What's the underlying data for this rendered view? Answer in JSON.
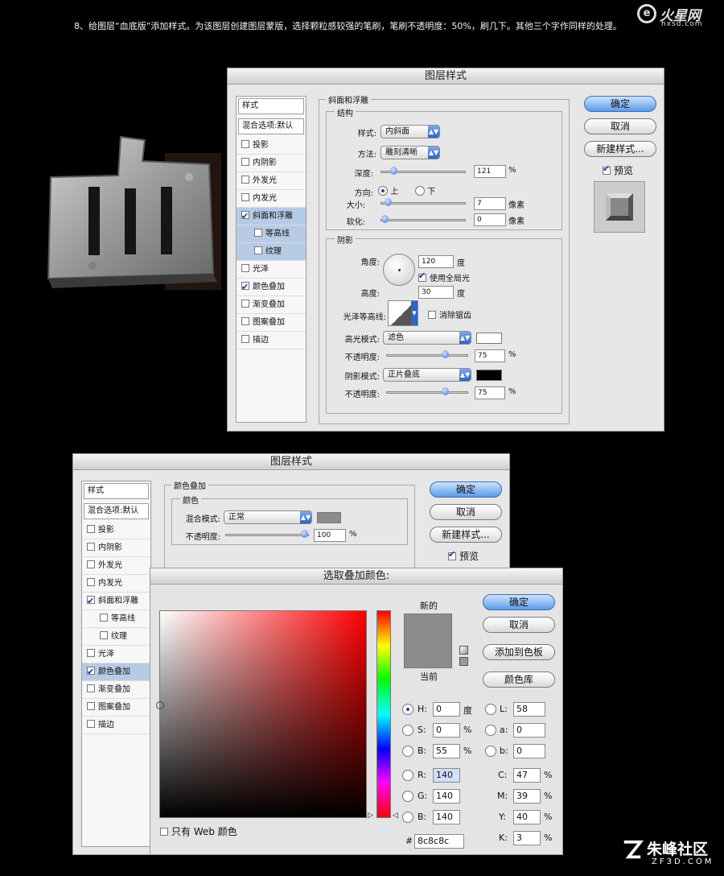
{
  "instruction": "8、给图层“血底版”添加样式。为该图层创建图层蒙版，选择颗粒感较强的笔刷，笔刷不透明度：50%，刷几下。其他三个字作同样的处理。",
  "top_logo": {
    "main": "火星网",
    "sub": "hxsd.com"
  },
  "bottom_logo": {
    "main": "朱峰社区",
    "sub": "ZF3D.COM"
  },
  "dialog1": {
    "title": "图层样式",
    "styles_header": "样式",
    "blend_default": "混合选项:默认",
    "items": [
      {
        "label": "投影",
        "checked": false,
        "active": false,
        "sub": false
      },
      {
        "label": "内阴影",
        "checked": false,
        "active": false,
        "sub": false
      },
      {
        "label": "外发光",
        "checked": false,
        "active": false,
        "sub": false
      },
      {
        "label": "内发光",
        "checked": false,
        "active": false,
        "sub": false
      },
      {
        "label": "斜面和浮雕",
        "checked": true,
        "active": true,
        "sub": false
      },
      {
        "label": "等高线",
        "checked": false,
        "active": true,
        "sub": true
      },
      {
        "label": "纹理",
        "checked": false,
        "active": true,
        "sub": true
      },
      {
        "label": "光泽",
        "checked": false,
        "active": false,
        "sub": false
      },
      {
        "label": "颜色叠加",
        "checked": true,
        "active": false,
        "sub": false
      },
      {
        "label": "渐变叠加",
        "checked": false,
        "active": false,
        "sub": false
      },
      {
        "label": "图案叠加",
        "checked": false,
        "active": false,
        "sub": false
      },
      {
        "label": "描边",
        "checked": false,
        "active": false,
        "sub": false
      }
    ],
    "section_title": "斜面和浮雕",
    "structure": {
      "title": "结构",
      "style_label": "样式:",
      "style_value": "内斜面",
      "technique_label": "方法:",
      "technique_value": "雕刻清晰",
      "depth_label": "深度:",
      "depth_value": "121",
      "depth_unit": "%",
      "depth_fraction": 0.12,
      "direction_label": "方向:",
      "direction_up": "上",
      "direction_down": "下",
      "size_label": "大小:",
      "size_value": "7",
      "size_unit": "像素",
      "size_fraction": 0.04,
      "soften_label": "软化:",
      "soften_value": "0",
      "soften_unit": "像素",
      "soften_fraction": 0.0
    },
    "shading": {
      "title": "阴影",
      "angle_label": "角度:",
      "angle_value": "120",
      "angle_unit": "度",
      "global_light_label": "使用全局光",
      "altitude_label": "高度:",
      "altitude_value": "30",
      "altitude_unit": "度",
      "gloss_label": "光泽等高线:",
      "antialias_label": "消除锯齿",
      "highlight_label": "高光模式:",
      "highlight_value": "滤色",
      "highlight_color": "#ffffff",
      "hl_opacity_label": "不透明度:",
      "hl_opacity_value": "75",
      "hl_opacity_unit": "%",
      "hl_fraction": 0.75,
      "shadow_label": "阴影模式:",
      "shadow_value": "正片叠底",
      "shadow_color": "#000000",
      "sh_opacity_label": "不透明度:",
      "sh_opacity_value": "75",
      "sh_opacity_unit": "%",
      "sh_fraction": 0.75
    },
    "buttons": {
      "ok": "确定",
      "cancel": "取消",
      "new_style": "新建样式...",
      "preview": "预览"
    }
  },
  "dialog2": {
    "title": "图层样式",
    "styles_header": "样式",
    "blend_default": "混合选项:默认",
    "items": [
      {
        "label": "投影",
        "checked": false,
        "active": false,
        "sub": false
      },
      {
        "label": "内阴影",
        "checked": false,
        "active": false,
        "sub": false
      },
      {
        "label": "外发光",
        "checked": false,
        "active": false,
        "sub": false
      },
      {
        "label": "内发光",
        "checked": false,
        "active": false,
        "sub": false
      },
      {
        "label": "斜面和浮雕",
        "checked": true,
        "active": false,
        "sub": false
      },
      {
        "label": "等高线",
        "checked": false,
        "active": false,
        "sub": true
      },
      {
        "label": "纹理",
        "checked": false,
        "active": false,
        "sub": true
      },
      {
        "label": "光泽",
        "checked": false,
        "active": false,
        "sub": false
      },
      {
        "label": "颜色叠加",
        "checked": true,
        "active": true,
        "sub": false
      },
      {
        "label": "渐变叠加",
        "checked": false,
        "active": false,
        "sub": false
      },
      {
        "label": "图案叠加",
        "checked": false,
        "active": false,
        "sub": false
      },
      {
        "label": "描边",
        "checked": false,
        "active": false,
        "sub": false
      }
    ],
    "section_title": "颜色叠加",
    "color_group": "颜色",
    "blend_label": "混合模式:",
    "blend_value": "正常",
    "overlay_color": "#8c8c8c",
    "opacity_label": "不透明度:",
    "opacity_value": "100",
    "opacity_unit": "%",
    "opacity_fraction": 1.0,
    "buttons": {
      "ok": "确定",
      "cancel": "取消",
      "new_style": "新建样式...",
      "preview": "预览"
    }
  },
  "picker": {
    "title": "选取叠加颜色:",
    "new_label": "新的",
    "current_label": "当前",
    "new_color": "#8c8c8c",
    "current_color": "#8c8c8c",
    "buttons": {
      "ok": "确定",
      "cancel": "取消",
      "add_swatch": "添加到色板",
      "library": "颜色库"
    },
    "web_only": "只有 Web 颜色",
    "H": {
      "label": "H:",
      "value": "0",
      "unit": "度"
    },
    "S": {
      "label": "S:",
      "value": "0",
      "unit": "%"
    },
    "Bv": {
      "label": "B:",
      "value": "55",
      "unit": "%"
    },
    "R": {
      "label": "R:",
      "value": "140"
    },
    "G": {
      "label": "G:",
      "value": "140"
    },
    "Bc": {
      "label": "B:",
      "value": "140"
    },
    "L": {
      "label": "L:",
      "value": "58"
    },
    "a": {
      "label": "a:",
      "value": "0"
    },
    "b": {
      "label": "b:",
      "value": "0"
    },
    "C": {
      "label": "C:",
      "value": "47",
      "unit": "%"
    },
    "M": {
      "label": "M:",
      "value": "39",
      "unit": "%"
    },
    "Y": {
      "label": "Y:",
      "value": "40",
      "unit": "%"
    },
    "K": {
      "label": "K:",
      "value": "3",
      "unit": "%"
    },
    "hex_label": "#",
    "hex_value": "8c8c8c",
    "field_hue": "#ff0000"
  }
}
